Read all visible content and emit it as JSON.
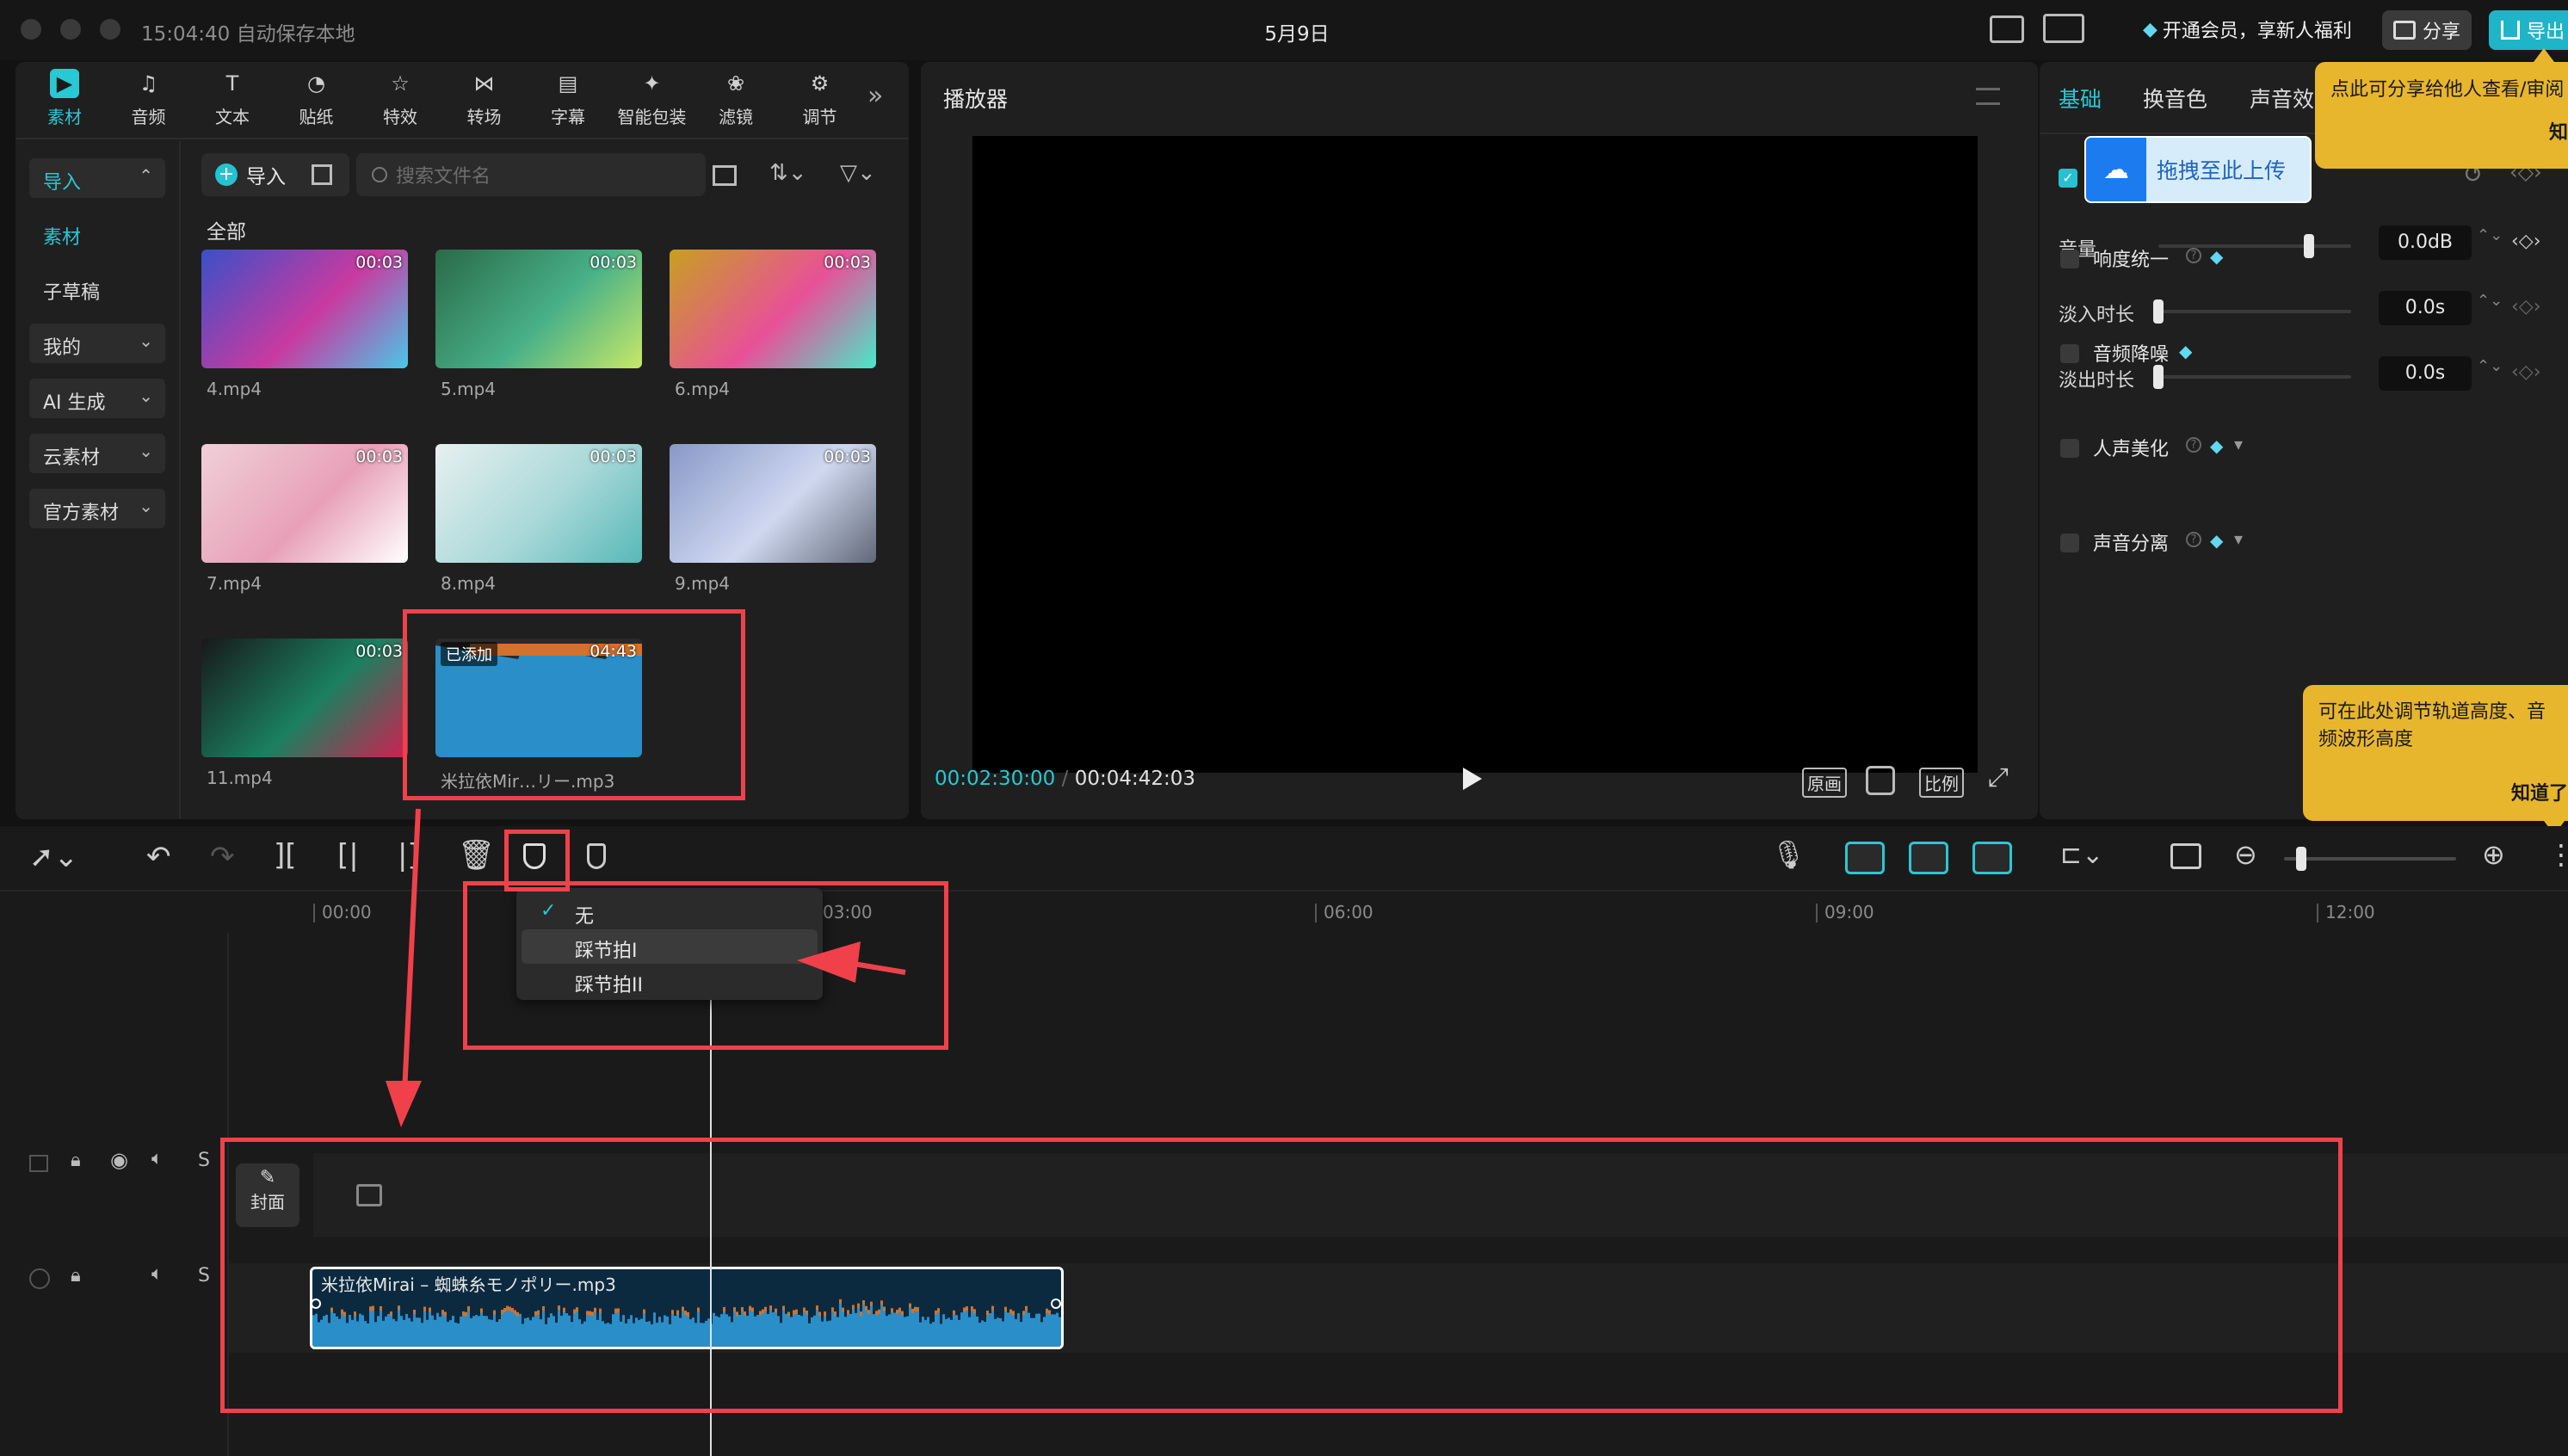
{
  "titlebar": {
    "autosave": "15:04:40 自动保存本地",
    "project_title": "5月9日",
    "member_promo": "开通会员，享新人福利",
    "share_label": "分享",
    "export_label": "导出"
  },
  "toolbar": {
    "tabs": [
      {
        "label": "素材",
        "icon": "media-icon",
        "active": true
      },
      {
        "label": "音频",
        "icon": "audio-icon"
      },
      {
        "label": "文本",
        "icon": "text-icon"
      },
      {
        "label": "贴纸",
        "icon": "sticker-icon"
      },
      {
        "label": "特效",
        "icon": "effects-icon"
      },
      {
        "label": "转场",
        "icon": "transition-icon"
      },
      {
        "label": "字幕",
        "icon": "subtitle-icon"
      },
      {
        "label": "智能包装",
        "icon": "smart-pack-icon"
      },
      {
        "label": "滤镜",
        "icon": "filter-icon"
      },
      {
        "label": "调节",
        "icon": "adjust-icon"
      }
    ]
  },
  "media_nav": {
    "items": [
      {
        "label": "导入",
        "active": true,
        "chevron": true
      },
      {
        "label": "素材",
        "green": true
      },
      {
        "label": "子草稿"
      },
      {
        "label": "我的",
        "chevron": true
      },
      {
        "label": "AI 生成",
        "chevron": true
      },
      {
        "label": "云素材",
        "chevron": true
      },
      {
        "label": "官方素材",
        "chevron": true
      }
    ]
  },
  "media": {
    "import_label": "导入",
    "search_placeholder": "搜索文件名",
    "section_label": "全部",
    "items": [
      {
        "name": "4.mp4",
        "duration": "00:03"
      },
      {
        "name": "5.mp4",
        "duration": "00:03"
      },
      {
        "name": "6.mp4",
        "duration": "00:03"
      },
      {
        "name": "7.mp4",
        "duration": "00:03"
      },
      {
        "name": "8.mp4",
        "duration": "00:03"
      },
      {
        "name": "9.mp4",
        "duration": "00:03"
      },
      {
        "name": "11.mp4",
        "duration": "00:03"
      },
      {
        "name": "米拉依Mir…リー.mp3",
        "duration": "04:43",
        "badge": "已添加"
      }
    ]
  },
  "player": {
    "title": "播放器",
    "current_time": "00:02:30:00",
    "total_time": "00:04:42:03",
    "btn_original": "原画",
    "btn_ratio": "比例"
  },
  "inspector": {
    "tabs": [
      "基础",
      "换音色",
      "声音效"
    ],
    "upload_label": "拖拽至此上传",
    "sliders": [
      {
        "label": "音量",
        "value": "0.0dB",
        "level": 0.78
      },
      {
        "label": "淡入时长",
        "value": "0.0s",
        "level": 0
      },
      {
        "label": "淡出时长",
        "value": "0.0s",
        "level": 0
      }
    ],
    "options": [
      {
        "label": "响度统一",
        "chevron": false
      },
      {
        "label": "音频降噪",
        "chevron": false
      },
      {
        "label": "人声美化",
        "chevron": true
      },
      {
        "label": "声音分离",
        "chevron": true
      }
    ],
    "tooltip_share": "点此可分享给他人查看/审阅",
    "tooltip_share_btn": "知",
    "tooltip_track": "可在此处调节轨道高度、音频波形高度",
    "tooltip_track_btn": "知道了"
  },
  "timeline": {
    "ruler": [
      "00:00",
      "03:00",
      "06:00",
      "09:00",
      "12:00"
    ],
    "beat_menu": [
      {
        "label": "无",
        "checked": true
      },
      {
        "label": "踩节拍I",
        "hover": true
      },
      {
        "label": "踩节拍II"
      }
    ],
    "cover_label": "封面",
    "audio_clip_label": "米拉依Mirai – 蜘蛛糸モノポリー.mp3",
    "solo_label": "S"
  },
  "colors": {
    "accent": "#28c8d4",
    "highlight": "#f0414b",
    "tooltip": "#e8b62c",
    "waveform": "#2a8ec8",
    "peak": "#d4712a"
  }
}
